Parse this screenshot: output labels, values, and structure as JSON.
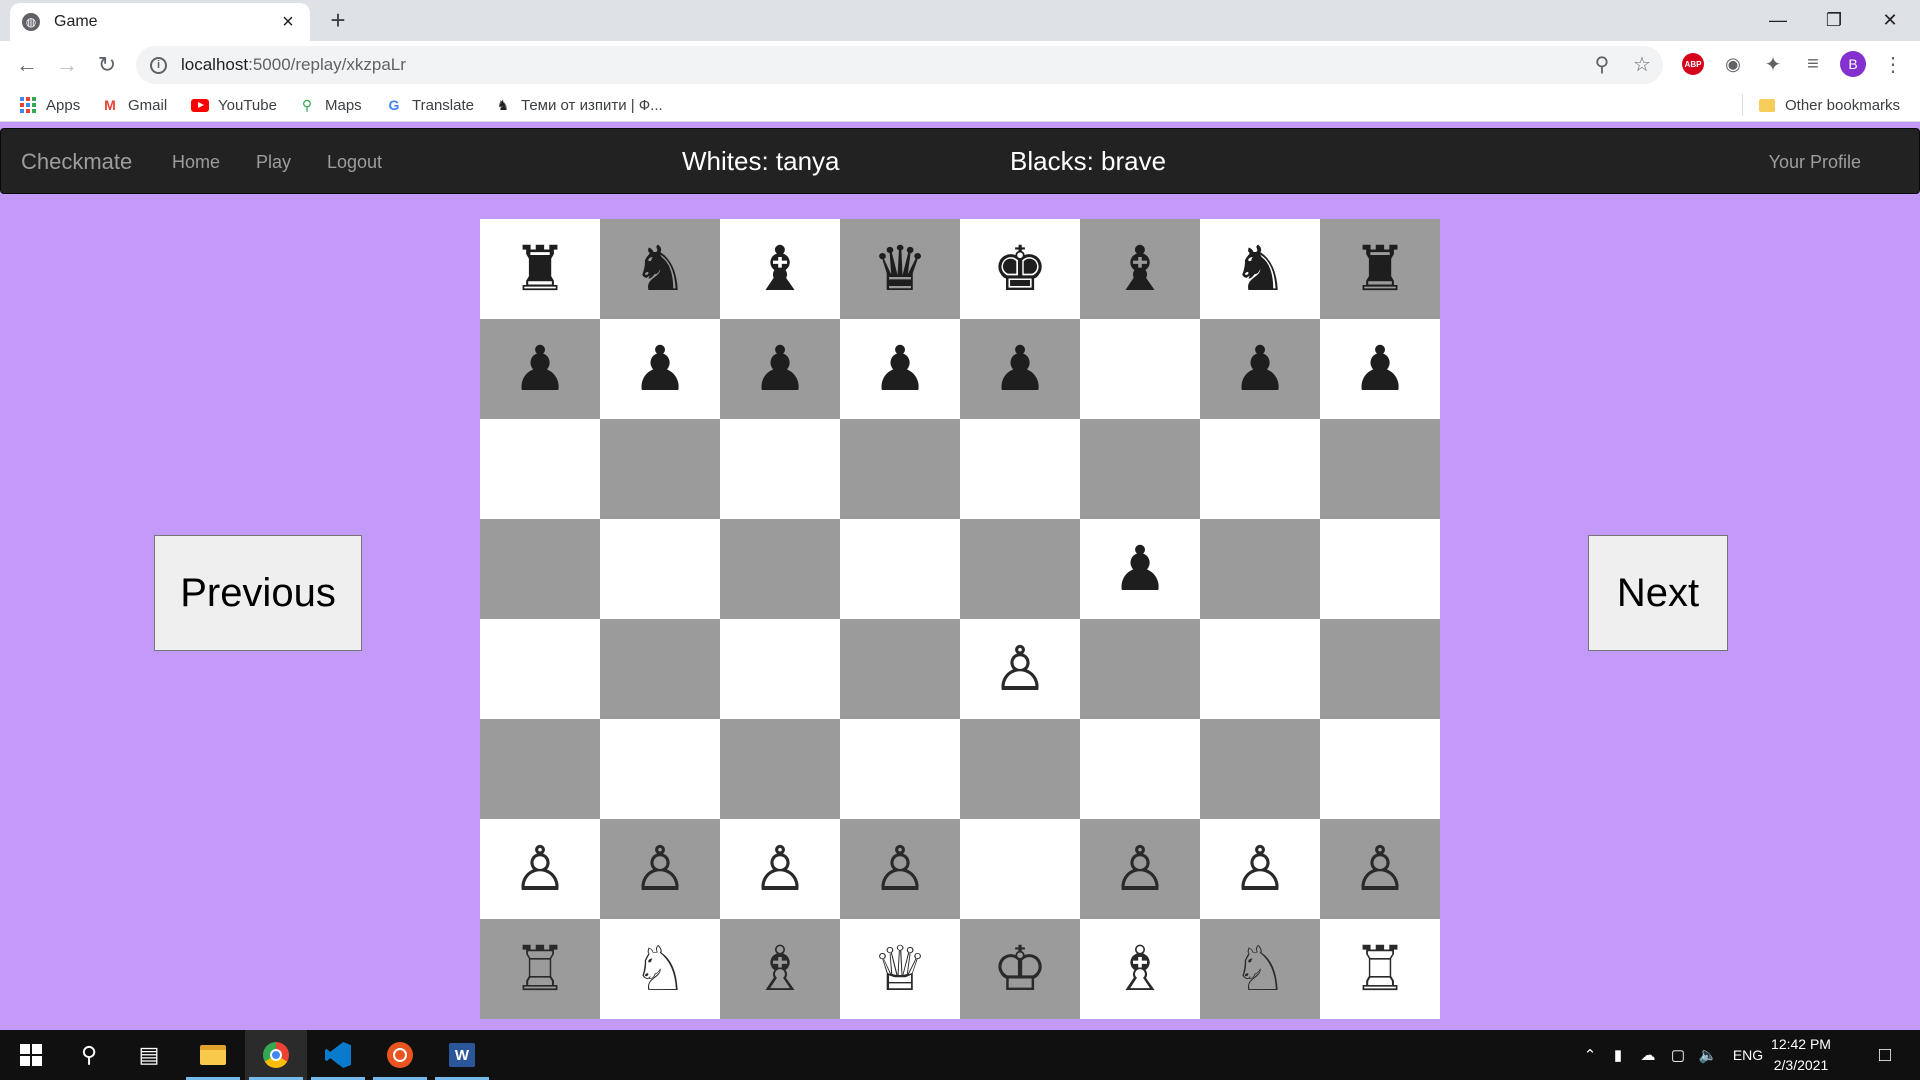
{
  "browser": {
    "tab_title": "Game",
    "new_tab_symbol": "+",
    "url_host": "localhost",
    "url_path": ":5000/replay/xkzpaLr",
    "profile_initial": "B",
    "abp_label": "ABP"
  },
  "bookmarks": [
    {
      "label": "Apps",
      "icon": "apps-grid-icon"
    },
    {
      "label": "Gmail",
      "icon": "gmail-icon"
    },
    {
      "label": "YouTube",
      "icon": "youtube-icon"
    },
    {
      "label": "Maps",
      "icon": "maps-icon"
    },
    {
      "label": "Translate",
      "icon": "translate-icon"
    },
    {
      "label": "Теми от изпити | Ф...",
      "icon": "chess-knight-icon"
    }
  ],
  "other_bookmarks": "Other bookmarks",
  "navbar": {
    "brand": "Checkmate",
    "links": [
      "Home",
      "Play",
      "Logout"
    ],
    "whites": "Whites: tanya",
    "blacks": "Blacks: brave",
    "profile": "Your Profile"
  },
  "board": {
    "rows": [
      [
        "br",
        "bn",
        "bb",
        "bq",
        "bk",
        "bb",
        "bn",
        "br"
      ],
      [
        "bp",
        "bp",
        "bp",
        "bp",
        "bp",
        "",
        "bp",
        "bp"
      ],
      [
        "",
        "",
        "",
        "",
        "",
        "",
        "",
        ""
      ],
      [
        "",
        "",
        "",
        "",
        "",
        "bp",
        "",
        ""
      ],
      [
        "",
        "",
        "",
        "",
        "wp",
        "",
        "",
        ""
      ],
      [
        "",
        "",
        "",
        "",
        "",
        "",
        "",
        ""
      ],
      [
        "wp",
        "wp",
        "wp",
        "wp",
        "",
        "wp",
        "wp",
        "wp"
      ],
      [
        "wr",
        "wn",
        "wb",
        "wq",
        "wk",
        "wb",
        "wn",
        "wr"
      ]
    ],
    "glyphs": {
      "br": "♜",
      "bn": "♞",
      "bb": "♝",
      "bq": "♛",
      "bk": "♚",
      "bp": "♟",
      "wr": "♖",
      "wn": "♘",
      "wb": "♗",
      "wq": "♕",
      "wk": "♔",
      "wp": "♙"
    },
    "colors": {
      "light": "#ffffff",
      "dark": "#9b9b9b"
    }
  },
  "controls": {
    "previous": "Previous",
    "next": "Next"
  },
  "taskbar": {
    "language": "ENG",
    "time": "12:42 PM",
    "date": "2/3/2021",
    "word_letter": "W"
  },
  "colors": {
    "page_background": "#c39af7",
    "navbar_background": "#222222"
  }
}
